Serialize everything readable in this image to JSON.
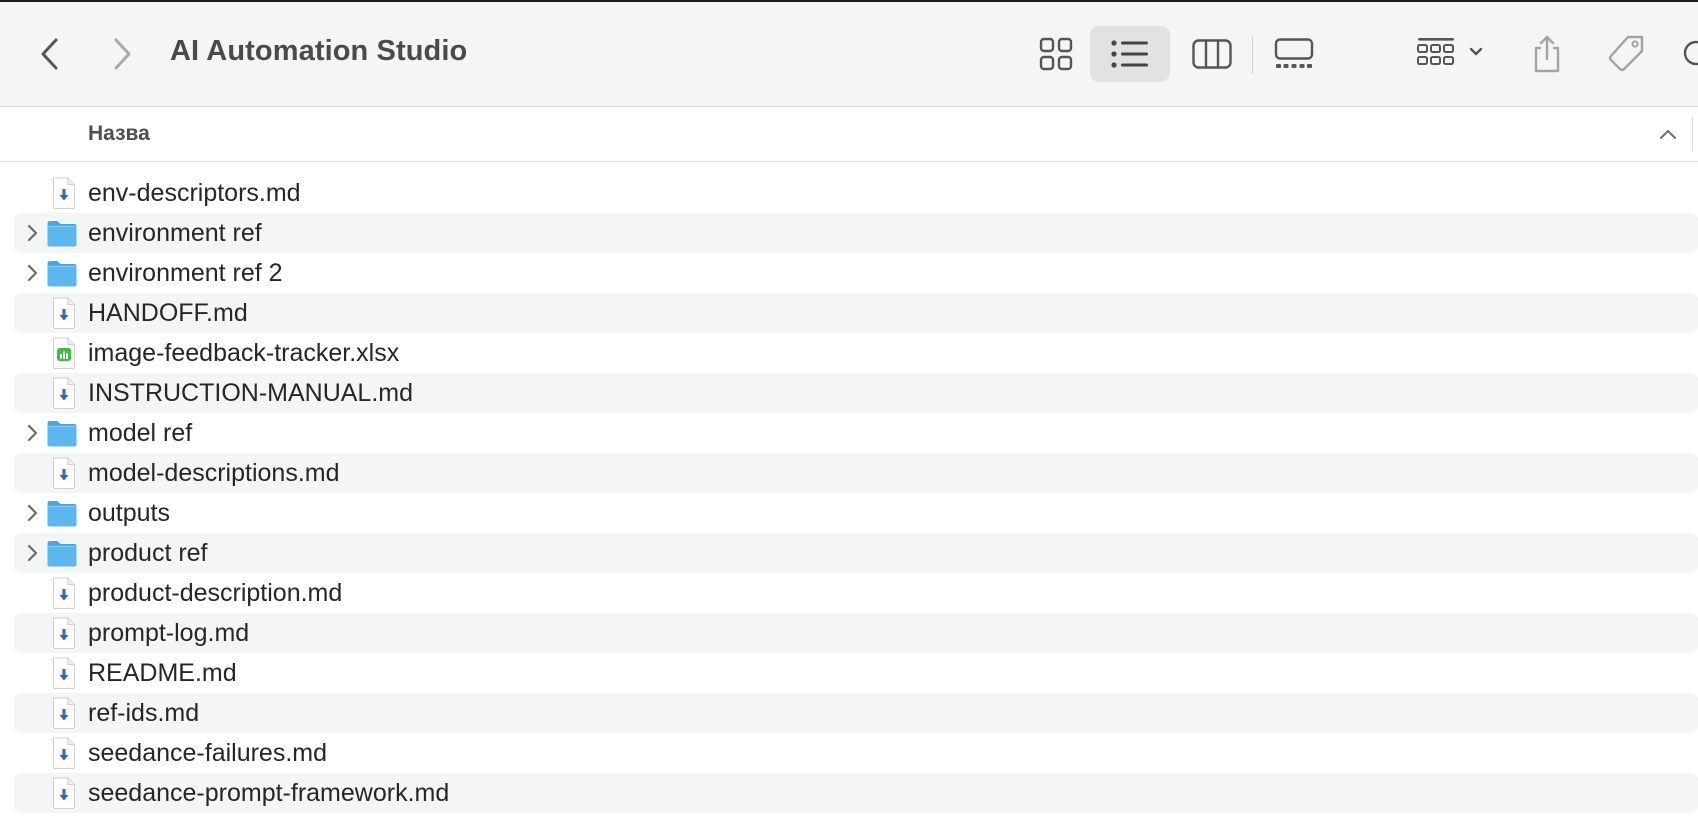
{
  "window": {
    "title": "AI Automation Studio"
  },
  "toolbar": {
    "back": {
      "icon": "chevron-left-icon"
    },
    "forward": {
      "icon": "chevron-right-icon",
      "enabled": false
    },
    "views": [
      {
        "name": "icons",
        "icon": "grid-icon",
        "selected": false
      },
      {
        "name": "list",
        "icon": "list-icon",
        "selected": true
      },
      {
        "name": "columns",
        "icon": "columns-icon",
        "selected": false
      },
      {
        "name": "gallery",
        "icon": "gallery-icon",
        "selected": false
      }
    ],
    "group_icon": "group-grid-icon",
    "share_icon": "share-icon",
    "tag_icon": "tag-icon",
    "search_icon": "search-icon"
  },
  "list_header": {
    "name_column": "Назва",
    "sort": "ascending"
  },
  "colors": {
    "toolbar_bg": "#f6f5f4",
    "selected_view_bg": "#e3e2e1",
    "row_stripe": "#f4f5f5",
    "folder_blue": "#5bb7ee",
    "text": "#262626"
  },
  "files": [
    {
      "name": "env-descriptors.md",
      "kind": "markdown",
      "icon": "markdown-file-icon",
      "expandable": false
    },
    {
      "name": "environment ref",
      "kind": "folder",
      "icon": "folder-icon",
      "expandable": true
    },
    {
      "name": "environment ref 2",
      "kind": "folder",
      "icon": "folder-icon",
      "expandable": true
    },
    {
      "name": "HANDOFF.md",
      "kind": "markdown",
      "icon": "markdown-file-icon",
      "expandable": false
    },
    {
      "name": "image-feedback-tracker.xlsx",
      "kind": "spreadsheet",
      "icon": "spreadsheet-file-icon",
      "expandable": false
    },
    {
      "name": "INSTRUCTION-MANUAL.md",
      "kind": "markdown",
      "icon": "markdown-file-icon",
      "expandable": false
    },
    {
      "name": "model ref",
      "kind": "folder",
      "icon": "folder-icon",
      "expandable": true
    },
    {
      "name": "model-descriptions.md",
      "kind": "markdown",
      "icon": "markdown-file-icon",
      "expandable": false
    },
    {
      "name": "outputs",
      "kind": "folder",
      "icon": "folder-icon",
      "expandable": true
    },
    {
      "name": "product ref",
      "kind": "folder",
      "icon": "folder-icon",
      "expandable": true
    },
    {
      "name": "product-description.md",
      "kind": "markdown",
      "icon": "markdown-file-icon",
      "expandable": false
    },
    {
      "name": "prompt-log.md",
      "kind": "markdown",
      "icon": "markdown-file-icon",
      "expandable": false
    },
    {
      "name": "README.md",
      "kind": "markdown",
      "icon": "markdown-file-icon",
      "expandable": false
    },
    {
      "name": "ref-ids.md",
      "kind": "markdown",
      "icon": "markdown-file-icon",
      "expandable": false
    },
    {
      "name": "seedance-failures.md",
      "kind": "markdown",
      "icon": "markdown-file-icon",
      "expandable": false
    },
    {
      "name": "seedance-prompt-framework.md",
      "kind": "markdown",
      "icon": "markdown-file-icon",
      "expandable": false
    }
  ]
}
